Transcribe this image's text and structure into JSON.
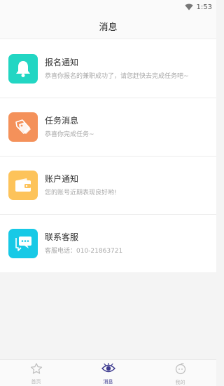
{
  "status": {
    "time": "1:53"
  },
  "header": {
    "title": "消息"
  },
  "messages": [
    {
      "title": "报名通知",
      "desc": "恭喜你报名的兼职成功了，请您赶快去完成任务吧~",
      "color": "#22d6c3",
      "icon": "bell-icon"
    },
    {
      "title": "任务消息",
      "desc": "恭喜你完成任务~",
      "color": "#f4915a",
      "icon": "tags-icon"
    },
    {
      "title": "账户通知",
      "desc": "您的账号近期表现良好哟!",
      "color": "#fdc35a",
      "icon": "wallet-icon"
    },
    {
      "title": "联系客服",
      "desc": "客服电话：010-21863721",
      "color": "#17c9e6",
      "icon": "chat-bubbles-icon"
    }
  ],
  "tabs": [
    {
      "label": "首页",
      "icon": "star-home-icon",
      "active": false
    },
    {
      "label": "消息",
      "icon": "eye-icon",
      "active": true
    },
    {
      "label": "我的",
      "icon": "profile-face-icon",
      "active": false
    }
  ]
}
